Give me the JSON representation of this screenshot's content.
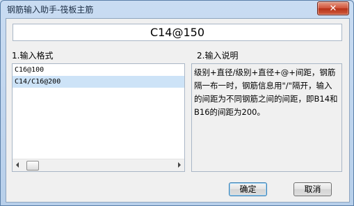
{
  "window": {
    "title": "钢筋输入助手-筏板主筋"
  },
  "main_input": {
    "value": "C14@150"
  },
  "format_section": {
    "label": "1.输入格式",
    "items": [
      "C16@100",
      "C14/C16@200"
    ],
    "selected_index": 1
  },
  "description_section": {
    "label": "2.输入说明",
    "text": "级别+直径/级别+直径+@+间距，钢筋隔一布一时，钢筋信息用\"/\"隔开，输入的间距为不同钢筋之间的间距，即B14和B16的间距为200。"
  },
  "buttons": {
    "ok": "确定",
    "cancel": "取消",
    "close": "✕"
  }
}
